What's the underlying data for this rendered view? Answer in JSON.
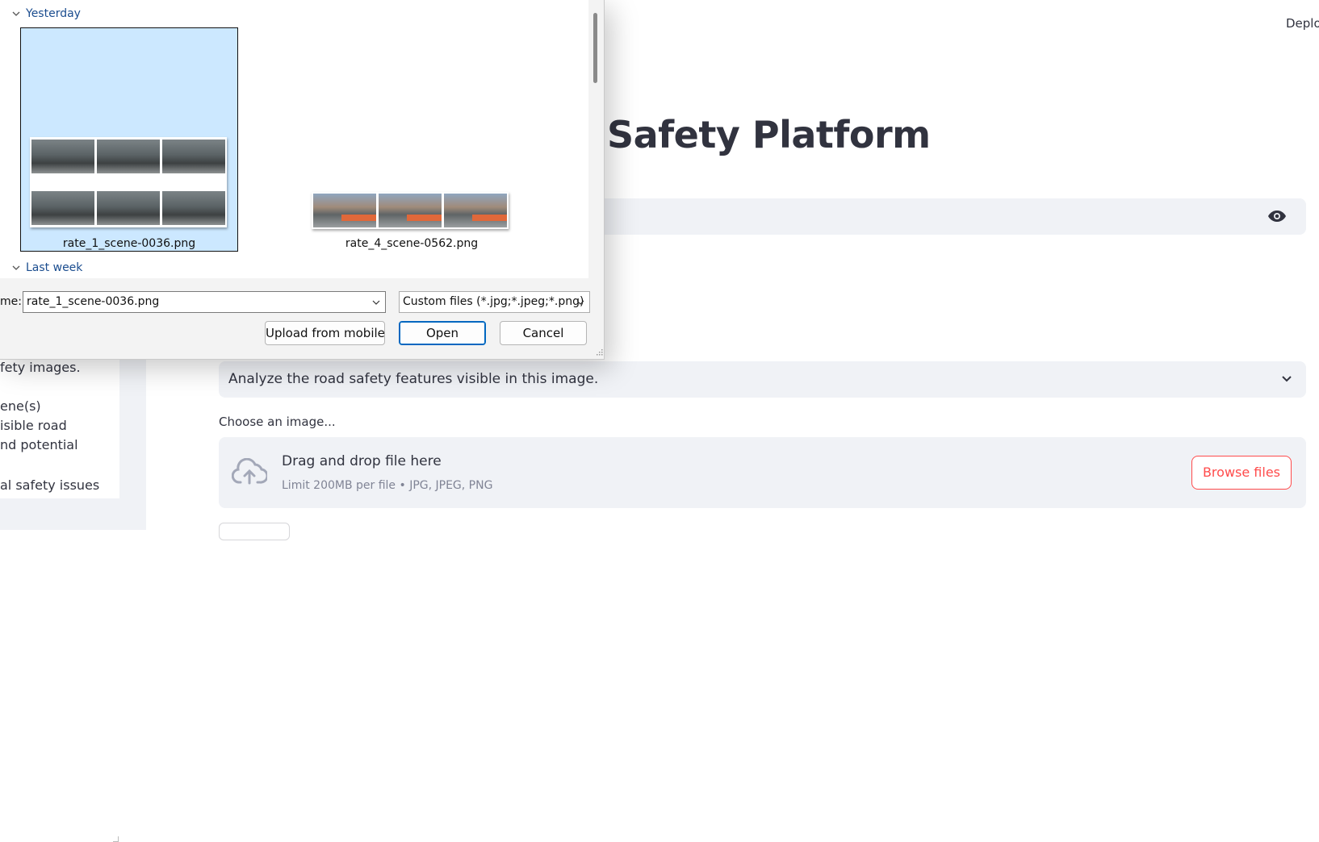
{
  "app": {
    "deploy_label": "Deploy",
    "title": "Safety Platform",
    "prompt_value": "Analyze the road safety features visible in this image.",
    "choose_label": "Choose an image...",
    "dropzone": {
      "title": "Drag and drop file here",
      "limit": "Limit 200MB per file • JPG, JPEG, PNG",
      "browse_label": "Browse files"
    },
    "sidebar_lines": [
      "fety images.",
      "ene(s)",
      "isible road",
      "nd potential",
      "al safety issues"
    ]
  },
  "dialog": {
    "groups": {
      "yesterday": "Yesterday",
      "last_week": "Last week"
    },
    "files": [
      {
        "name": "rate_1_scene-0036.png",
        "selected": true
      },
      {
        "name": "rate_4_scene-0562.png",
        "selected": false
      }
    ],
    "file_name_label": "me:",
    "file_name_value": "rate_1_scene-0036.png",
    "file_type_value": "Custom files (*.jpg;*.jpeg;*.png)",
    "buttons": {
      "upload_mobile": "Upload from mobile",
      "open": "Open",
      "cancel": "Cancel"
    }
  },
  "colors": {
    "accent_red": "#ff4b4b",
    "selection_blue": "#cce8ff",
    "link_blue": "#1b4d8f"
  }
}
